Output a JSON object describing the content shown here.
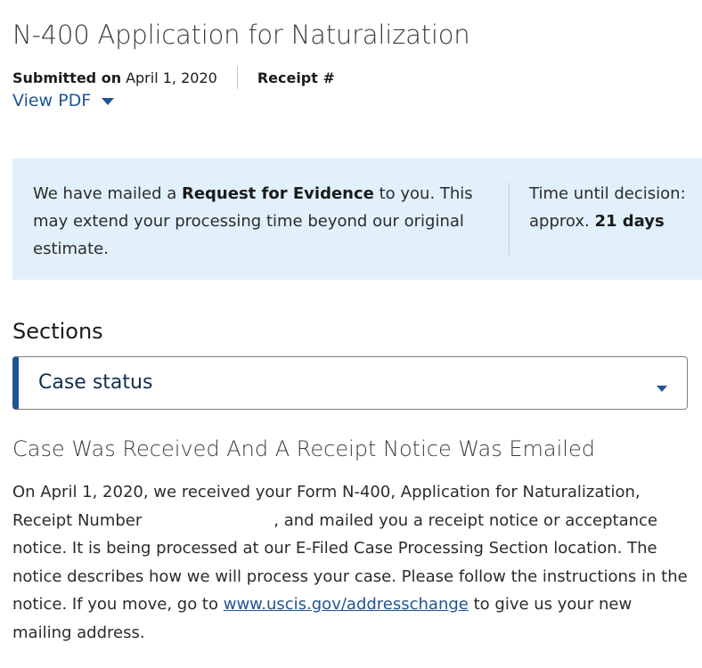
{
  "header": {
    "title": "N-400 Application for Naturalization",
    "submitted_label": "Submitted on",
    "submitted_date": "April 1, 2020",
    "receipt_label": "Receipt #",
    "view_pdf_label": "View PDF"
  },
  "alert": {
    "message_prefix": "We have mailed a ",
    "message_bold": "Request for Evidence",
    "message_suffix": " to you. This may extend your processing time beyond our original estimate.",
    "time_label": "Time until decision:",
    "time_prefix": "approx. ",
    "time_value": "21 days"
  },
  "sections": {
    "label": "Sections",
    "selected": "Case status"
  },
  "status": {
    "heading": "Case Was Received And A Receipt Notice Was Emailed",
    "body_part1": "On April 1, 2020, we received your Form N-400, Application for Naturalization, Receipt Number",
    "body_part2": ", and mailed you a receipt notice or acceptance notice. It is being processed at our E-Filed Case Processing Section location. The notice describes how we will process your case. Please follow the instructions in the notice. If you move, go to ",
    "link_text": "www.uscis.gov/addresschange",
    "body_part3": " to give us your new mailing address."
  },
  "colors": {
    "link": "#205493",
    "alert_bg": "#e1f0fb",
    "select_accent": "#205493"
  },
  "icons": {
    "view_pdf_caret": "caret-down-icon",
    "select_caret": "chevron-down-icon"
  }
}
